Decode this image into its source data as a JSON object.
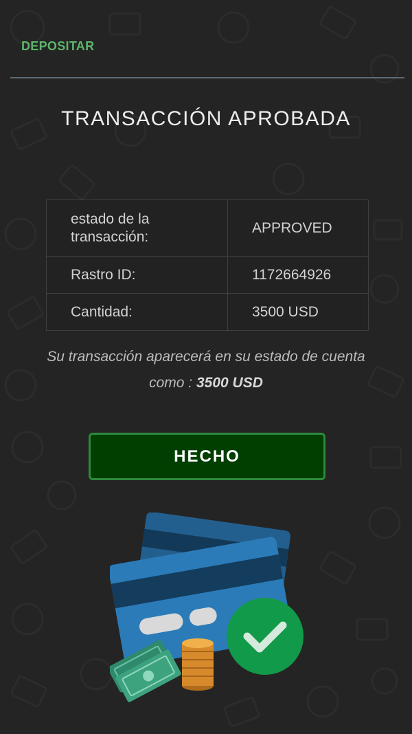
{
  "header": {
    "tab_label": "DEPOSITAR"
  },
  "title": "TRANSACCIÓN APROBADA",
  "details": {
    "rows": [
      {
        "label": "estado de la transacción:",
        "value": "APPROVED"
      },
      {
        "label": "Rastro ID:",
        "value": "1172664926"
      },
      {
        "label": "Cantidad:",
        "value": "3500 USD"
      }
    ]
  },
  "note": {
    "text": "Su transacción aparecerá en su estado de cuenta como : ",
    "amount": "3500 USD"
  },
  "done_button": {
    "label": "HECHO"
  },
  "illustration": {
    "icons": [
      "credit-card-icon",
      "cash-bills-icon",
      "coin-stack-icon",
      "check-circle-icon"
    ]
  },
  "colors": {
    "background": "#242424",
    "accent_green": "#5cb56a",
    "approved_green": "#6fe07c",
    "button_fill": "#003f00",
    "button_border": "#2c8a3b"
  }
}
